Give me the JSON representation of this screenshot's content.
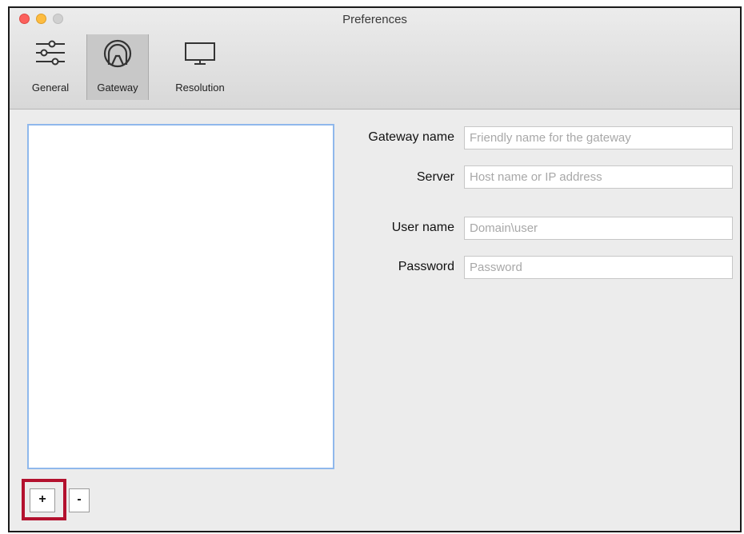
{
  "window": {
    "title": "Preferences"
  },
  "toolbar": {
    "general_label": "General",
    "gateway_label": "Gateway",
    "resolution_label": "Resolution",
    "selected": "Gateway"
  },
  "form": {
    "gateway_name": {
      "label": "Gateway name",
      "placeholder": "Friendly name for the gateway",
      "value": ""
    },
    "server": {
      "label": "Server",
      "placeholder": "Host name or IP address",
      "value": ""
    },
    "user_name": {
      "label": "User name",
      "placeholder": "Domain\\user",
      "value": ""
    },
    "password": {
      "label": "Password",
      "placeholder": "Password",
      "value": ""
    }
  },
  "list": {
    "items": []
  },
  "buttons": {
    "add_label": "+",
    "remove_label": "-"
  },
  "colors": {
    "highlight": "#b3112e",
    "list_focus": "#8fb8ec",
    "close": "#fc605c",
    "minimize": "#fdbc40"
  }
}
